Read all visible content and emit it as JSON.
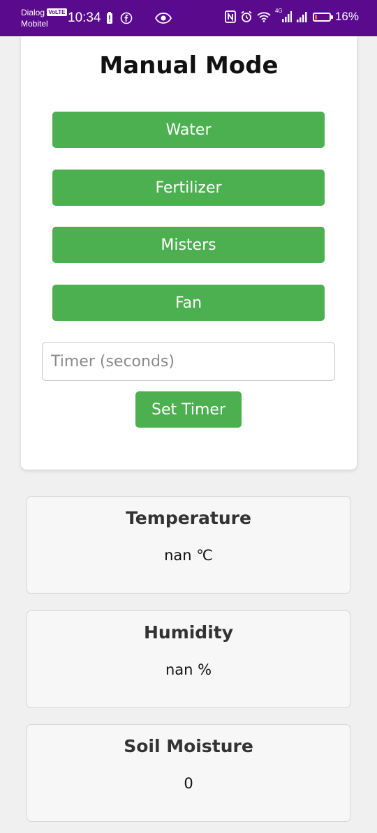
{
  "statusbar": {
    "carrier_line1": "Dialog",
    "volte": "VoLTE",
    "carrier_line2": "Mobitel",
    "time": "10:34",
    "network": "4G",
    "battery_percent": "16%",
    "battery_level": 0.16,
    "battery_color": "#ff6a1a",
    "bar_color": "#5a0a8c",
    "icons": [
      "battery-alert-icon",
      "facebook-icon",
      "eye-icon",
      "nfc-icon",
      "alarm-icon",
      "wifi-icon",
      "signal-icon",
      "signal-icon-2",
      "battery-icon"
    ]
  },
  "manual": {
    "title": "Manual Mode",
    "buttons": [
      "Water",
      "Fertilizer",
      "Misters",
      "Fan"
    ],
    "timer_placeholder": "Timer (seconds)",
    "set_timer_label": "Set Timer",
    "accent": "#4caf50"
  },
  "sensors": [
    {
      "label": "Temperature",
      "value": "nan ℃"
    },
    {
      "label": "Humidity",
      "value": "nan %"
    },
    {
      "label": "Soil Moisture",
      "value": "0"
    }
  ]
}
